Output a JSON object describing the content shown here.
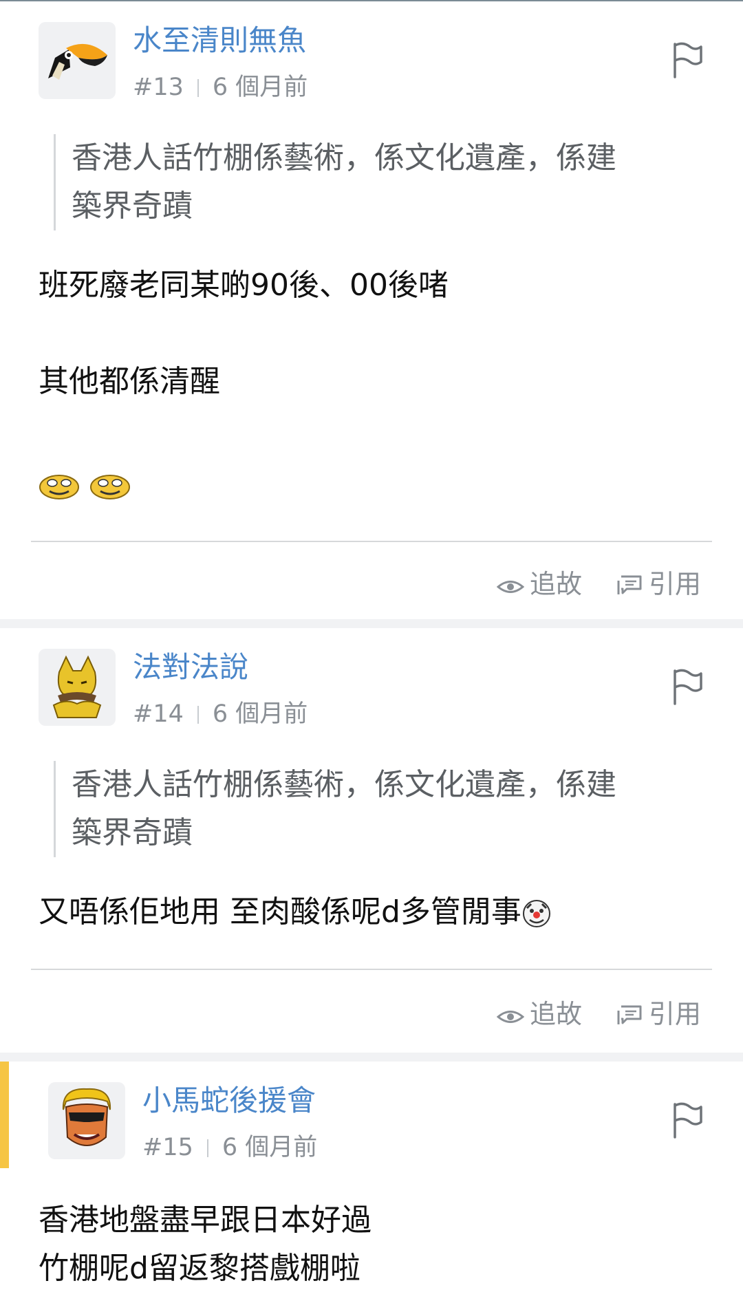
{
  "posts": [
    {
      "username": "水至清則無魚",
      "number": "#13",
      "time": "6 個月前",
      "quote": [
        "香港人話竹棚係藝術，係文化遺產，係建",
        "築界奇蹟"
      ],
      "body": [
        "班死廢老同某啲90後、00後啫",
        "其他都係清醒"
      ],
      "avatar_icon": "toucan-icon",
      "body_emoji": "sweating-face-emoji"
    },
    {
      "username": "法對法說",
      "number": "#14",
      "time": "6 個月前",
      "quote": [
        "香港人話竹棚係藝術，係文化遺產，係建",
        "築界奇蹟"
      ],
      "body": [
        "又唔係佢地用 至肉酸係呢d多管閒事"
      ],
      "avatar_icon": "abra-icon",
      "body_emoji": "clown-face-emoji"
    },
    {
      "username": "小馬蛇後援會",
      "number": "#15",
      "time": "6 個月前",
      "body": [
        "香港地盤盡早跟日本好過",
        "竹棚呢d留返黎搭戲棚啦"
      ],
      "avatar_icon": "sunglasses-face-icon",
      "highlighted": true
    }
  ],
  "actions": {
    "follow_label": "追故",
    "quote_label": "引用"
  },
  "colors": {
    "username": "#4a86c9",
    "meta": "#8a8f95",
    "quote_text": "#5b5f63",
    "highlight": "#f6c544",
    "separator": "#f1f2f4"
  }
}
